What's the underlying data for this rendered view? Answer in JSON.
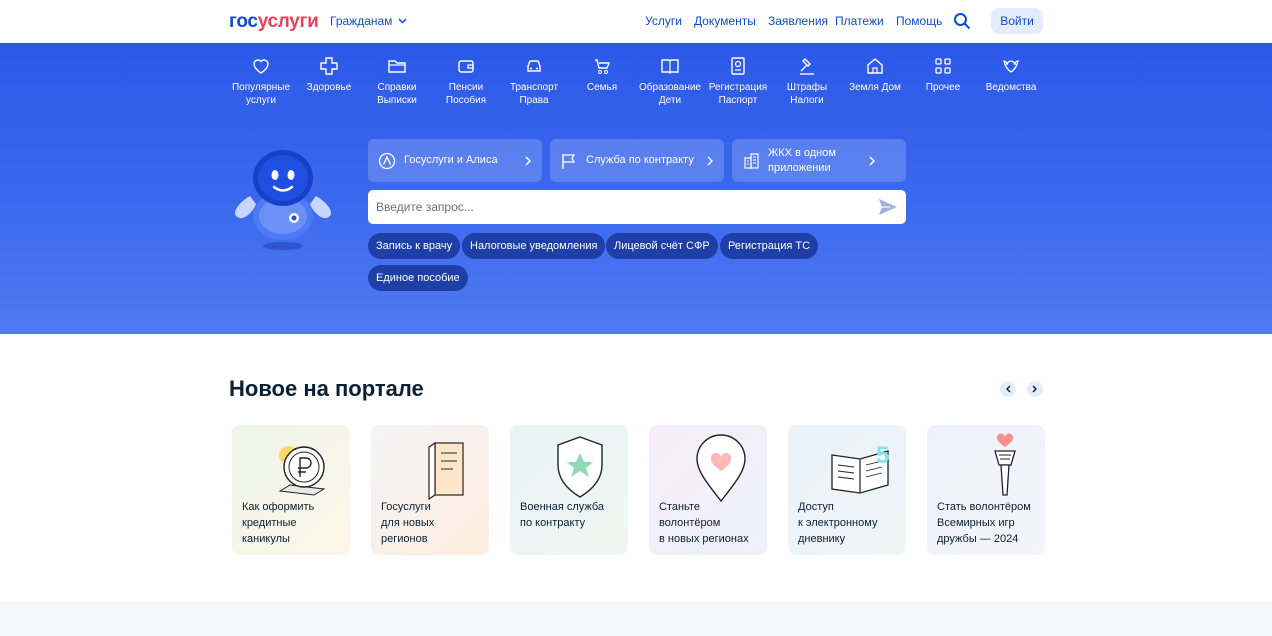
{
  "header": {
    "logo_part1": "гос",
    "logo_part2": "услуги",
    "citizens_label": "Гражданам",
    "nav": [
      "Услуги",
      "Документы",
      "Заявления",
      "Платежи",
      "Помощь"
    ],
    "login_label": "Войти"
  },
  "categories": [
    {
      "label": "Популярные\nуслуги",
      "icon": "heart-icon"
    },
    {
      "label": "Здоровье",
      "icon": "plus-cross-icon"
    },
    {
      "label": "Справки\nВыписки",
      "icon": "folder-icon"
    },
    {
      "label": "Пенсии\nПособия",
      "icon": "wallet-icon"
    },
    {
      "label": "Транспорт\nПрава",
      "icon": "car-icon"
    },
    {
      "label": "Семья",
      "icon": "stroller-icon"
    },
    {
      "label": "Образование\nДети",
      "icon": "book-icon"
    },
    {
      "label": "Регистрация\nПаспорт",
      "icon": "passport-icon"
    },
    {
      "label": "Штрафы\nНалоги",
      "icon": "gavel-icon"
    },
    {
      "label": "Земля Дом",
      "icon": "house-icon"
    },
    {
      "label": "Прочее",
      "icon": "grid-icon"
    },
    {
      "label": "Ведомства",
      "icon": "emblem-icon"
    }
  ],
  "promos": [
    {
      "label": "Госуслуги и Алиса",
      "icon": "alice-icon"
    },
    {
      "label": "Служба по контракту",
      "icon": "flag-icon"
    },
    {
      "label": "ЖКХ в одном приложении",
      "icon": "building-icon"
    }
  ],
  "search": {
    "placeholder": "Введите запрос..."
  },
  "chips": [
    "Запись к врачу",
    "Налоговые уведомления",
    "Лицевой счёт СФР",
    "Регистрация ТС",
    "Единое пособие"
  ],
  "news": {
    "title": "Новое на портале",
    "cards": [
      {
        "text": "Как оформить\nкредитные\nканикулы",
        "icon": "ruble-coin-icon",
        "bg": "#eef6ea"
      },
      {
        "text": "Госуслуги\nдля новых\nрегионов",
        "icon": "door-icon",
        "bg": "#fdf1e6"
      },
      {
        "text": "Военная служба\nпо контракту",
        "icon": "shield-star-icon",
        "bg": "#eaf4f6"
      },
      {
        "text": "Станьте\nволонтёром\nв новых регионах",
        "icon": "heart-pin-icon",
        "bg": "#f6eef8"
      },
      {
        "text": "Доступ\nк электронному\nдневнику",
        "icon": "open-book-icon",
        "bg": "#eaf2fa"
      },
      {
        "text": "Стать волонтёром\nВсемирных игр\nдружбы — 2024",
        "icon": "torch-icon",
        "bg": "#eef1fa"
      }
    ]
  },
  "colors": {
    "brand_blue": "#0d4cd3",
    "brand_red": "#ee3f58",
    "hero_blue": "#3b69ee",
    "chip_dark": "#1e3fa8"
  }
}
